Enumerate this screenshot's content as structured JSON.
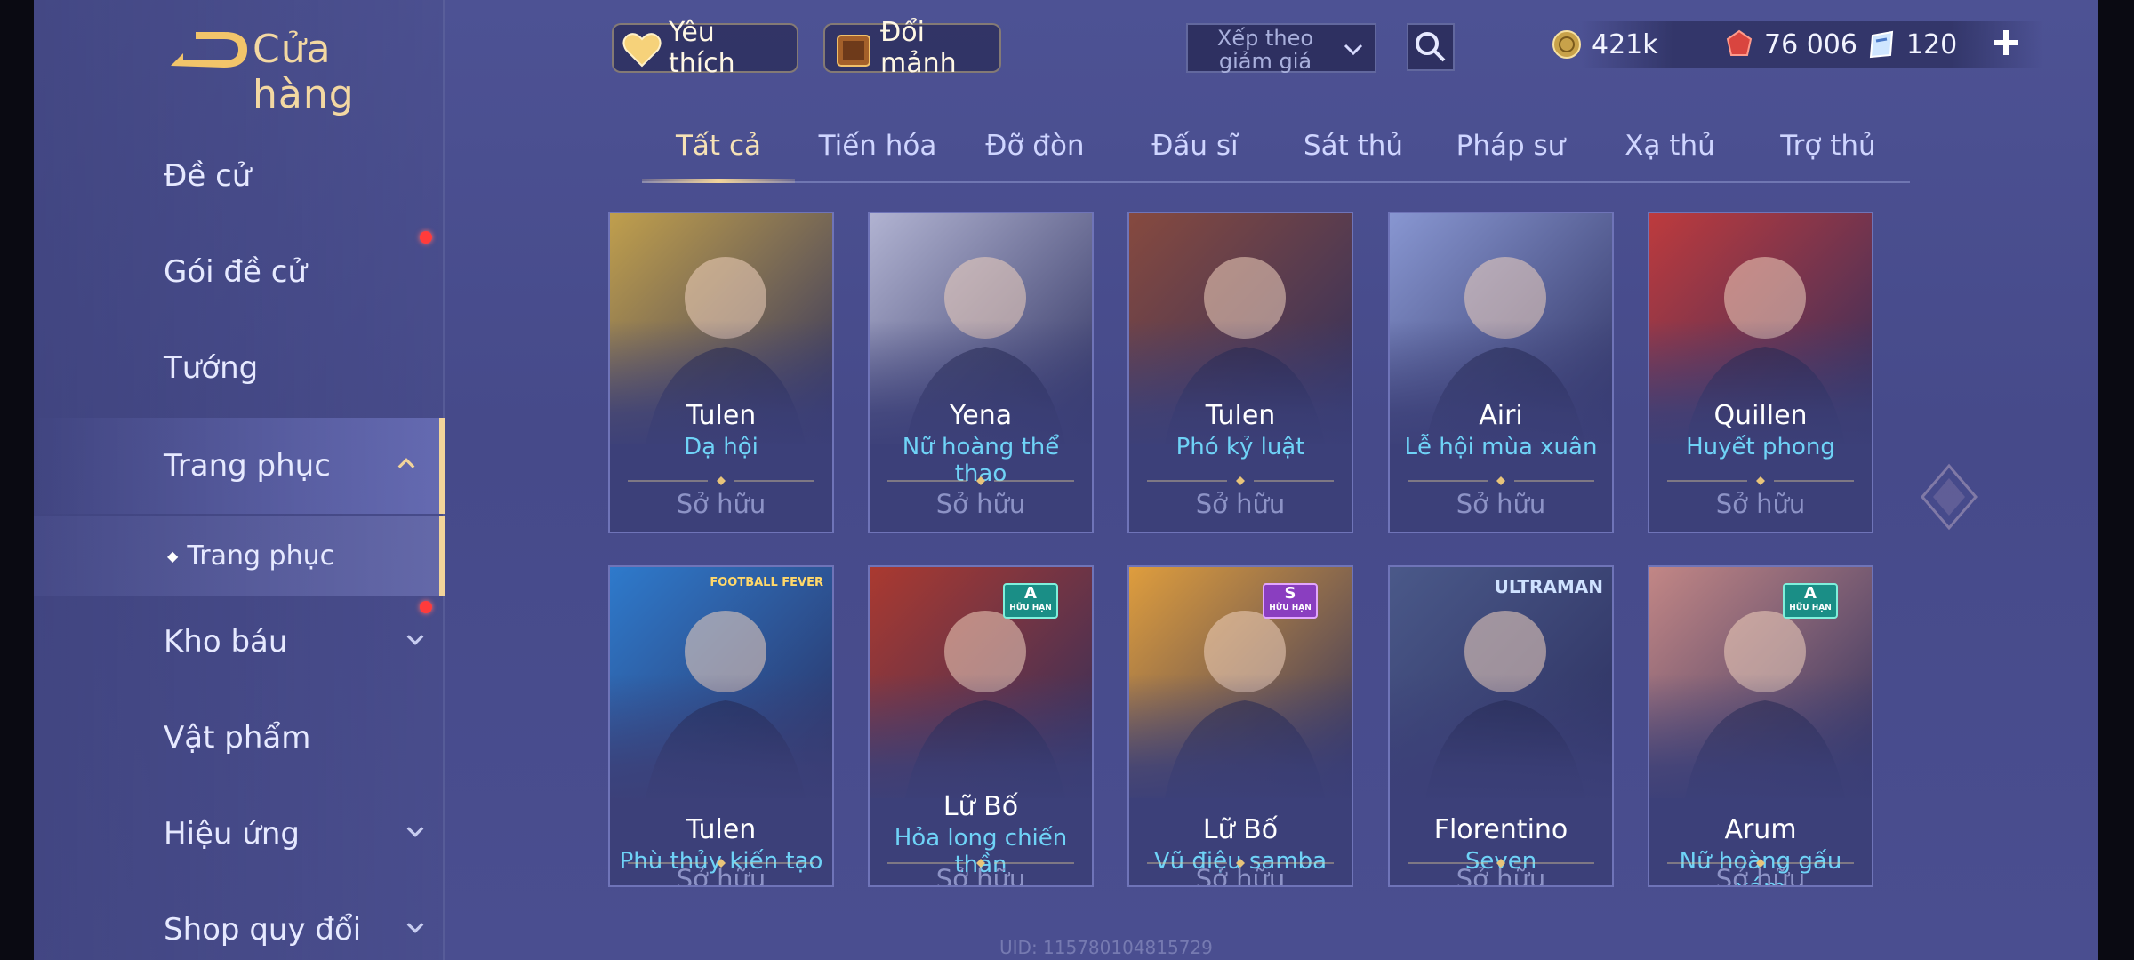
{
  "header": {
    "title": "Cửa hàng",
    "favorite_label": "Yêu thích",
    "exchange_label": "Đổi mảnh",
    "sort_label": "Xếp theo giảm giá",
    "currencies": [
      {
        "name": "gold-coin",
        "value": "421k"
      },
      {
        "name": "red-gem",
        "value": "76 006"
      },
      {
        "name": "blue-voucher",
        "value": "120"
      }
    ]
  },
  "sidebar": {
    "items": [
      {
        "label": "Đề cử",
        "has_dot": false
      },
      {
        "label": "Gói đề cử",
        "has_dot": true
      },
      {
        "label": "Tướng",
        "has_dot": false
      },
      {
        "label": "Trang phục",
        "expanded": true
      },
      {
        "label": "Trang phục",
        "sub": true
      },
      {
        "label": "Kho báu",
        "has_dot": true
      },
      {
        "label": "Vật phẩm",
        "has_dot": false
      },
      {
        "label": "Hiệu ứng",
        "has_dot": false
      },
      {
        "label": "Shop quy đổi",
        "has_dot": false
      }
    ]
  },
  "tabs": [
    "Tất cả",
    "Tiến hóa",
    "Đỡ đòn",
    "Đấu sĩ",
    "Sát thủ",
    "Pháp sư",
    "Xạ thủ",
    "Trợ thủ"
  ],
  "cards": [
    {
      "hero": "Tulen",
      "skin": "Dạ hội",
      "status": "Sở hữu",
      "badge": "",
      "accent": "#c7a44a"
    },
    {
      "hero": "Yena",
      "skin": "Nữ hoàng thể thao",
      "status": "Sở hữu",
      "badge": "",
      "accent": "#b7b9d6"
    },
    {
      "hero": "Tulen",
      "skin": "Phó kỷ luật",
      "status": "Sở hữu",
      "badge": "",
      "accent": "#8a4a3c"
    },
    {
      "hero": "Airi",
      "skin": "Lễ hội mùa xuân",
      "status": "Sở hữu",
      "badge": "",
      "accent": "#8c9bd6"
    },
    {
      "hero": "Quillen",
      "skin": "Huyết phong",
      "status": "Sở hữu",
      "badge": "",
      "accent": "#c43a3a"
    },
    {
      "hero": "Tulen",
      "skin": "Phù thủy kiến tạo",
      "status": "Sở hữu",
      "badge": "FOOTBALL FEVER",
      "accent": "#2e7dd0"
    },
    {
      "hero": "Lữ Bố",
      "skin": "Hỏa long chiến thần",
      "status": "Sở hữu",
      "badge": "A",
      "accent": "#b0392c"
    },
    {
      "hero": "Lữ Bố",
      "skin": "Vũ điệu samba",
      "status": "Sở hữu",
      "badge": "S",
      "accent": "#e7a23a"
    },
    {
      "hero": "Florentino",
      "skin": "Seven",
      "status": "Sở hữu",
      "badge": "ULTRAMAN",
      "accent": "#4b5a8a"
    },
    {
      "hero": "Arum",
      "skin": "Nữ hoàng gấu xám",
      "status": "Sở hữu",
      "badge": "A",
      "accent": "#c98a86"
    }
  ],
  "badge_subtext": "HỮU HẠN",
  "uid_text": "UID: 115780104815729",
  "colors": {
    "accent_gold": "#f2d49a",
    "skin_blue": "#6fd3f7",
    "owned_grey": "#8d93c6"
  }
}
